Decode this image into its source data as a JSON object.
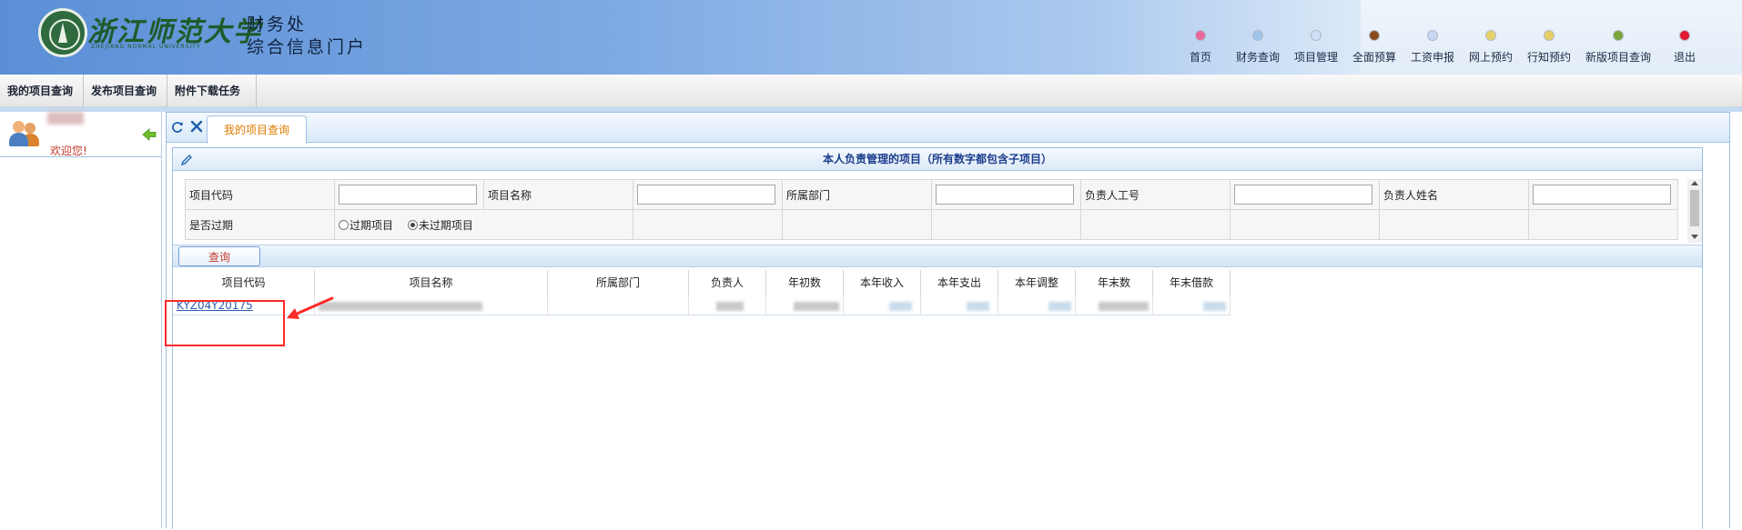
{
  "header": {
    "logo_text": "浙江师范大学",
    "logo_subtext": "ZHEJIANG NORMAL UNIVERSITY",
    "portal_title_line1": "财务处",
    "portal_title_line2": "综合信息门户",
    "nav": [
      {
        "label": "首页",
        "dot_color": "#e8689a"
      },
      {
        "label": "财务查询",
        "dot_color": "#9fc4ea"
      },
      {
        "label": "项目管理",
        "dot_color": "#cfe0f6"
      },
      {
        "label": "全面预算",
        "dot_color": "#8a4b1c"
      },
      {
        "label": "工资申报",
        "dot_color": "#c8d8f3"
      },
      {
        "label": "网上预约",
        "dot_color": "#e7d36a"
      },
      {
        "label": "行知预约",
        "dot_color": "#e4cf62"
      },
      {
        "label": "新版项目查询",
        "dot_color": "#7aa63a"
      },
      {
        "label": "退出",
        "dot_color": "#e3172d"
      }
    ]
  },
  "menubar": {
    "items": [
      "我的项目查询",
      "发布项目查询",
      "附件下载任务"
    ]
  },
  "sidebar": {
    "welcome": "欢迎您!"
  },
  "tabs": {
    "active_label": "我的项目查询"
  },
  "form": {
    "title": "本人负责管理的项目（所有数字都包含子项目）",
    "fields": {
      "code_label": "项目代码",
      "name_label": "项目名称",
      "dept_label": "所属部门",
      "owner_id_label": "负责人工号",
      "owner_name_label": "负责人姓名",
      "expired_label": "是否过期"
    },
    "radio": {
      "expired": "过期项目",
      "not_expired": "未过期项目",
      "selected": "未过期项目"
    },
    "query_button": "查询"
  },
  "grid": {
    "columns": [
      "项目代码",
      "项目名称",
      "所属部门",
      "负责人",
      "年初数",
      "本年收入",
      "本年支出",
      "本年调整",
      "年末数",
      "年末借款"
    ],
    "rows": [
      {
        "code": "KYZ04Y20175"
      }
    ]
  },
  "colors": {
    "accent_orange": "#e07b00",
    "annotation_red": "#ff2a2a",
    "link_blue": "#2a5db0"
  }
}
